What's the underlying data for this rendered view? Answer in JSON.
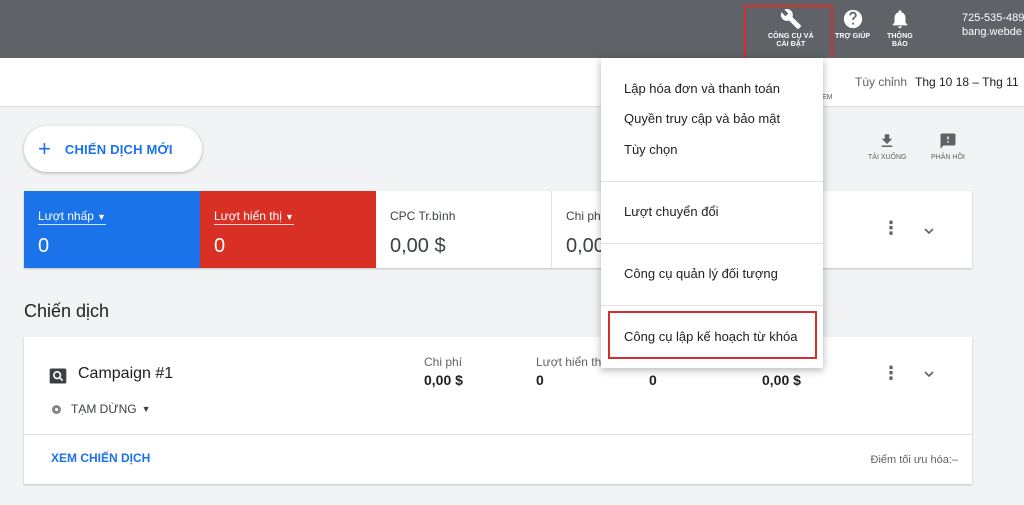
{
  "topbar": {
    "tools_label_1": "CÔNG CỤ VÀ",
    "tools_label_2": "CÀI ĐẶT",
    "help_label": "TRỢ GIÚP",
    "notifications_label_1": "THÔNG",
    "notifications_label_2": "BÁO",
    "account_id": "725-535-489",
    "account_name": "bang.webde"
  },
  "subheader": {
    "date_label": "Tùy chỉnh",
    "date_range": "Thg 10 18 – Thg 11",
    "truncated_text": "EM"
  },
  "toolbar": {
    "new_campaign_plus": "+",
    "new_campaign_label": "CHIẾN DỊCH MỚI",
    "download_label": "TẢI XUỐNG",
    "feedback_label": "PHẢN HỒI"
  },
  "metrics": [
    {
      "label": "Lượt nhấp",
      "value": "0"
    },
    {
      "label": "Lượt hiển thị",
      "value": "0"
    },
    {
      "label": "CPC Tr.bình",
      "value": "0,00 $"
    },
    {
      "label": "Chi ph",
      "value": "0,00"
    }
  ],
  "section_title": "Chiến dịch",
  "campaign": {
    "name": "Campaign #1",
    "status": "TẠM DỪNG",
    "columns": [
      {
        "label": "Chi phí",
        "value": "0,00 $"
      },
      {
        "label": "Lượt hiển thị",
        "value": "0"
      },
      {
        "label": "",
        "value": "0"
      },
      {
        "label": "",
        "value": "0,00 $"
      }
    ],
    "view_link": "XEM CHIẾN DỊCH",
    "optimization_score": "Điểm tối ưu hóa:–"
  },
  "menu": {
    "items": [
      "Lập hóa đơn và thanh toán",
      "Quyền truy cập và bảo mật",
      "Tùy chọn",
      "Lượt chuyển đổi",
      "Công cụ quản lý đối tượng",
      "Công cụ lập kế hoạch từ khóa"
    ]
  },
  "colors": {
    "topbar": "#5f6368",
    "accent_blue": "#1a73e8",
    "accent_red": "#d93025",
    "highlight_border": "#d32f2f"
  },
  "icons": [
    "wrench-icon",
    "help-icon",
    "bell-icon",
    "download-icon",
    "feedback-icon",
    "search-icon",
    "more-vert-icon",
    "chevron-down-icon"
  ]
}
